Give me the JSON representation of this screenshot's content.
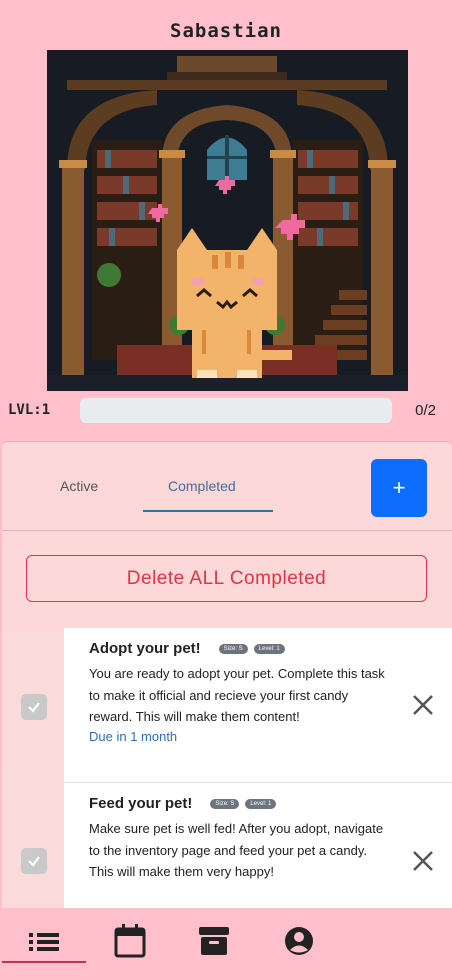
{
  "pet": {
    "name": "Sabastian",
    "level_label": "LVL:1",
    "xp_fraction": 0.0,
    "xp_count": "0/2"
  },
  "tasks_panel": {
    "tabs": [
      {
        "label": "Active",
        "active": false
      },
      {
        "label": "Completed",
        "active": true
      }
    ],
    "add_button_label": "+",
    "delete_all_label": "Delete ALL Completed"
  },
  "tasks": [
    {
      "title": "Adopt your pet!",
      "size_badge": "Size: S",
      "level_badge": "Level: 1",
      "description": "You are ready to adopt your pet. Complete this task to make it official and recieve your first candy reward. This will make them content!",
      "due": "Due in 1 month",
      "checked": true
    },
    {
      "title": "Feed your pet!",
      "size_badge": "Size: S",
      "level_badge": "Level: 1",
      "description": "Make sure pet is well fed! After you adopt, navigate to the inventory page and feed your pet a candy. This will make them very happy!",
      "checked": true
    }
  ],
  "bottom_nav": [
    {
      "icon": "list-icon",
      "active": true
    },
    {
      "icon": "calendar-icon",
      "active": false
    },
    {
      "icon": "archive-icon",
      "active": false
    },
    {
      "icon": "account-icon",
      "active": false
    }
  ],
  "colors": {
    "background": "#ffc0cb",
    "panel": "#fcd8d8",
    "primary": "#0d6efd",
    "danger": "#dc3545",
    "tab_active": "#3b6ea5",
    "due_text": "#2f6db3"
  }
}
